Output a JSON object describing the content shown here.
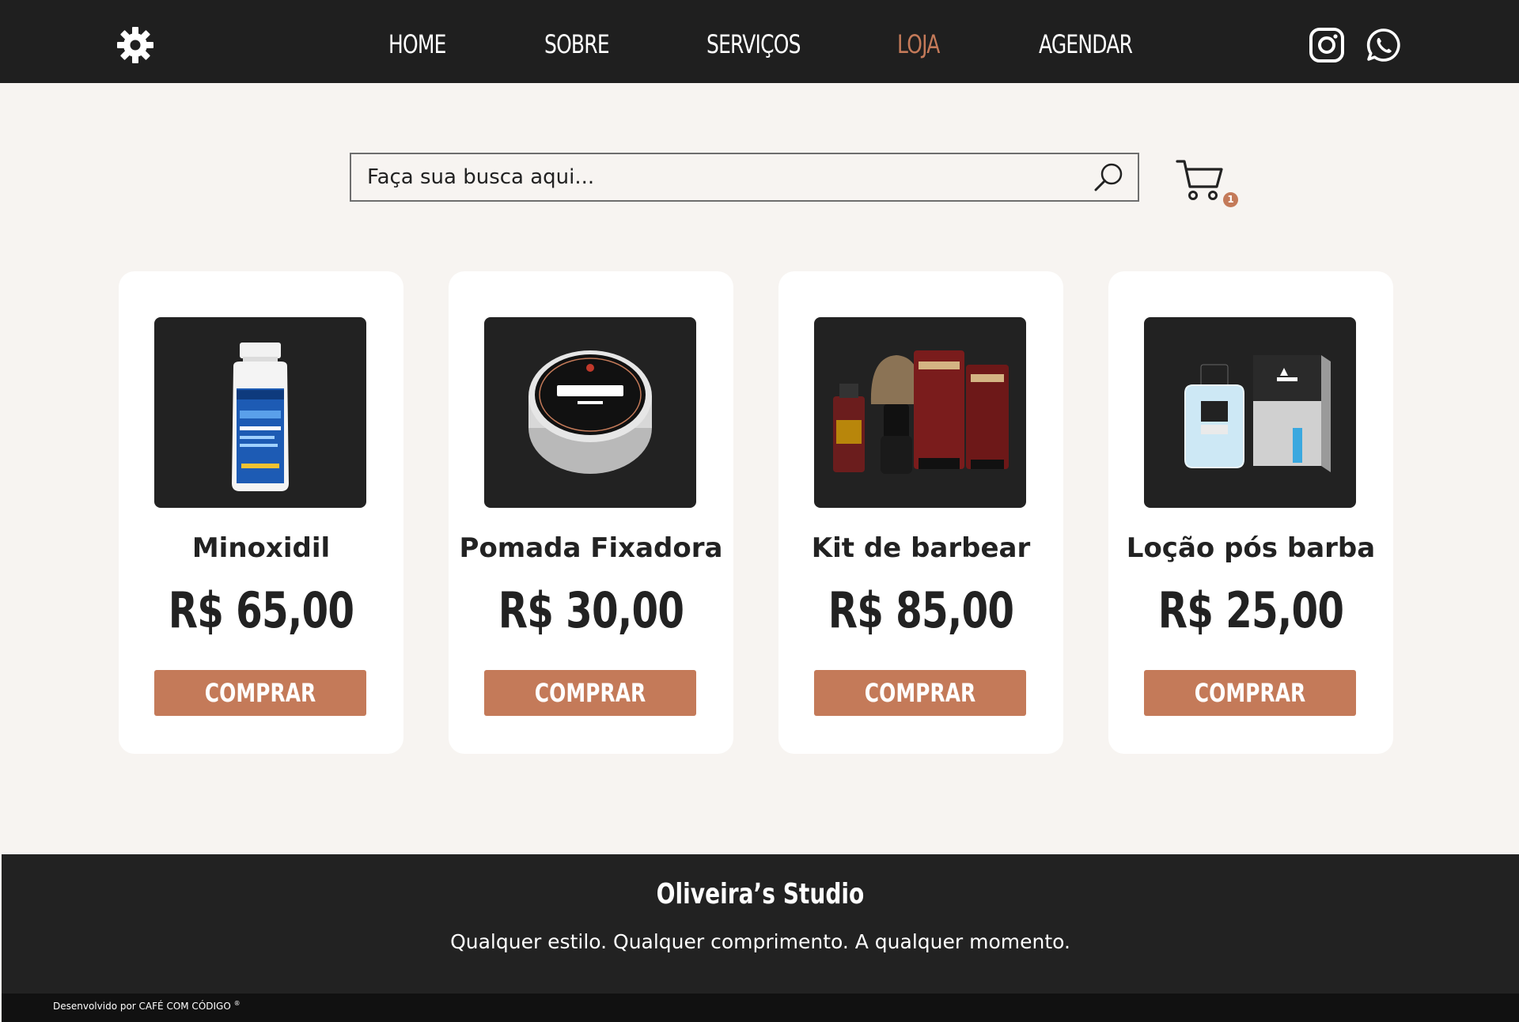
{
  "nav": {
    "items": [
      {
        "label": "HOME"
      },
      {
        "label": "SOBRE"
      },
      {
        "label": "SERVIÇOS"
      },
      {
        "label": "LOJA",
        "active": true
      },
      {
        "label": "AGENDAR"
      }
    ],
    "icons": [
      "gear-icon",
      "instagram-icon",
      "whatsapp-icon"
    ]
  },
  "search": {
    "placeholder": "Faça sua busca aqui..."
  },
  "cart": {
    "count": "1"
  },
  "products": [
    {
      "name": "Minoxidil",
      "price": "R$ 65,00",
      "button": "COMPRAR"
    },
    {
      "name": "Pomada Fixadora",
      "price": "R$ 30,00",
      "button": "COMPRAR"
    },
    {
      "name": "Kit de barbear",
      "price": "R$ 85,00",
      "button": "COMPRAR"
    },
    {
      "name": "Loção pós barba",
      "price": "R$ 25,00",
      "button": "COMPRAR"
    }
  ],
  "footer": {
    "title": "Oliveira’s Studio",
    "tagline": "Qualquer estilo. Qualquer comprimento. A qualquer momento.",
    "credit": "Desenvolvido por CAFÉ COM CÓDIGO",
    "credit_mark": "®"
  },
  "colors": {
    "accent": "#c47a59",
    "dark": "#1f1f1f",
    "background": "#f7f4f1"
  }
}
